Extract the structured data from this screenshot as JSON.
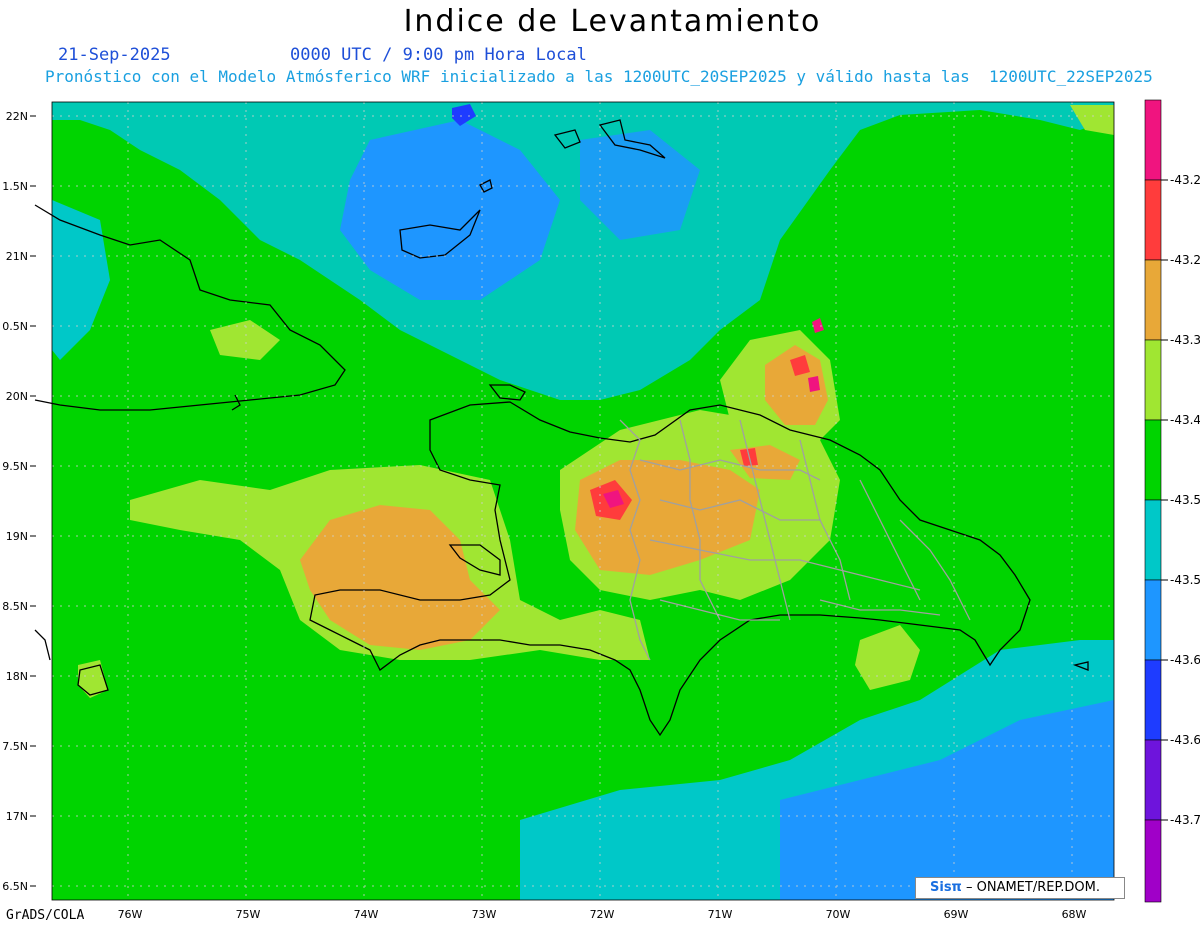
{
  "header": {
    "title": "Indice de Levantamiento",
    "date": "21-Sep-2025",
    "time": "0000 UTC / 9:00 pm Hora Local",
    "description": "Pronóstico con el Modelo Atmósferico WRF inicializado a las 1200UTC_20SEP2025 y válido hasta las  1200UTC_22SEP2025"
  },
  "axes": {
    "lat_labels": [
      "22N",
      "1.5N",
      "21N",
      "0.5N",
      "20N",
      "9.5N",
      "19N",
      "8.5N",
      "18N",
      "7.5N",
      "17N",
      "6.5N"
    ],
    "lon_labels": [
      "76W",
      "75W",
      "74W",
      "73W",
      "72W",
      "71W",
      "70W",
      "69W",
      "68W"
    ]
  },
  "legend": {
    "labels": [
      "-43.2",
      "-43.2",
      "-43.3",
      "-43.4",
      "-43.5",
      "-43.5",
      "-43.6",
      "-43.6",
      "-43.7"
    ],
    "colors": [
      "#f0147f",
      "#ff3c3c",
      "#e8a838",
      "#a0e632",
      "#00d400",
      "#00c8c8",
      "#1e96ff",
      "#1e3cff",
      "#6e14dc",
      "#a000c8"
    ]
  },
  "footer": {
    "software": "GrADS/COLA",
    "logo": "Sisπ",
    "org": "– ONAMET/REP.DOM."
  },
  "colors": {
    "ocean_green": "#00d400",
    "cyan": "#00c8c8",
    "blue": "#1e96ff",
    "yellowgreen": "#a0e632",
    "orange": "#e8a838",
    "red": "#ff3c3c",
    "magenta": "#f0147f"
  }
}
